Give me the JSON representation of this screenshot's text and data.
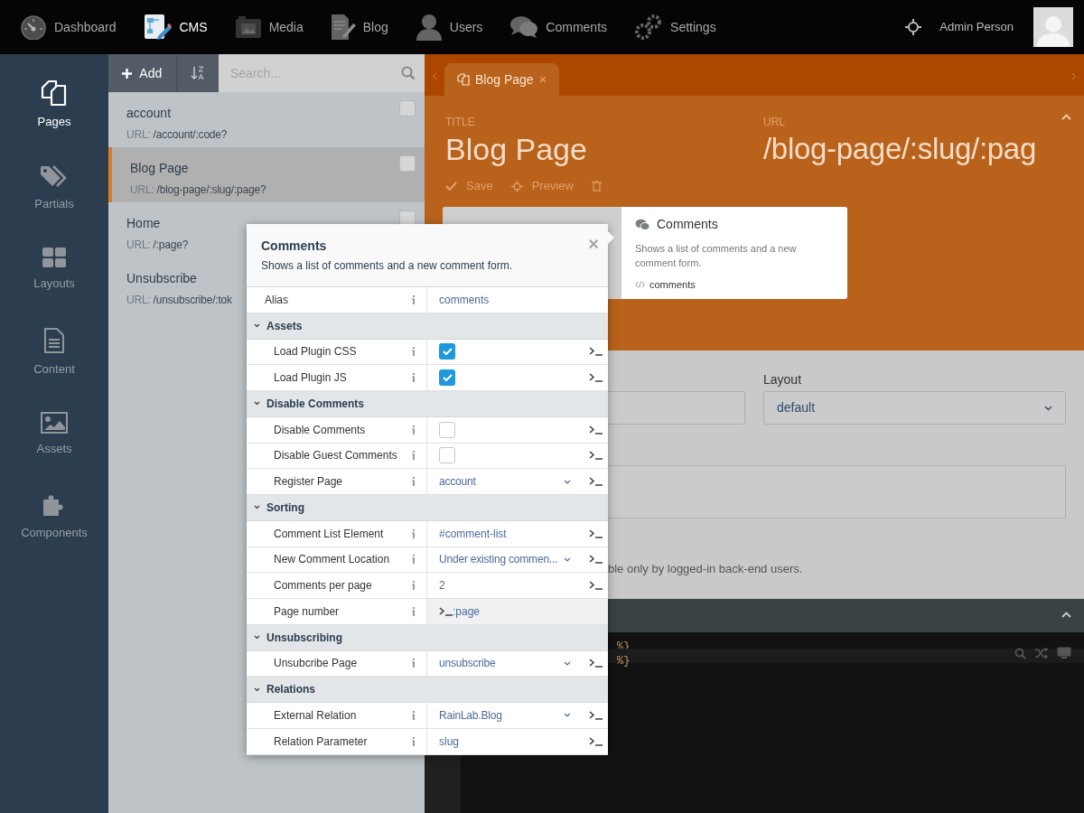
{
  "nav": {
    "items": [
      {
        "label": "Dashboard",
        "selected": false
      },
      {
        "label": "CMS",
        "selected": true
      },
      {
        "label": "Media",
        "selected": false
      },
      {
        "label": "Blog",
        "selected": false
      },
      {
        "label": "Users",
        "selected": false
      },
      {
        "label": "Comments",
        "selected": false
      },
      {
        "label": "Settings",
        "selected": false
      }
    ],
    "user": "Admin Person"
  },
  "sidebar": [
    {
      "label": "Pages",
      "selected": true
    },
    {
      "label": "Partials",
      "selected": false
    },
    {
      "label": "Layouts",
      "selected": false
    },
    {
      "label": "Content",
      "selected": false
    },
    {
      "label": "Assets",
      "selected": false
    },
    {
      "label": "Components",
      "selected": false
    }
  ],
  "list": {
    "add": "Add",
    "search_placeholder": "Search...",
    "items": [
      {
        "title": "account",
        "url_label": "URL:",
        "url": "/account/:code?",
        "selected": false
      },
      {
        "title": "Blog Page",
        "url_label": "URL:",
        "url": "/blog-page/:slug/:page?",
        "selected": true
      },
      {
        "title": "Home",
        "url_label": "URL:",
        "url": "/:page?",
        "selected": false
      },
      {
        "title": "Unsubscribe",
        "url_label": "URL:",
        "url": "/unsubscribe/:tok",
        "selected": false
      }
    ]
  },
  "editor": {
    "tab": {
      "label": "Blog Page",
      "close": "×"
    },
    "title_label": "TITLE",
    "title": "Blog Page",
    "url_label": "URL",
    "url": "/blog-page/:slug/:pag",
    "actions": [
      "Save",
      "Preview"
    ],
    "component_card": {
      "title": "Comments",
      "description": "Shows a list of comments and a new comment form.",
      "alias": "comments"
    },
    "layout_label": "Layout",
    "layout": "default",
    "hint": "ble only by logged-in back-end users.",
    "code_lines": [
      "%}",
      "%}"
    ]
  },
  "inspector": {
    "title": "Comments",
    "description": "Shows a list of comments and a new comment form.",
    "close": "×",
    "rows": [
      {
        "kind": "text",
        "label": "Alias",
        "value": "comments",
        "code_toggle": false
      },
      {
        "kind": "group",
        "label": "Assets"
      },
      {
        "kind": "checkbox",
        "label": "Load Plugin CSS",
        "checked": true,
        "code_toggle": true
      },
      {
        "kind": "checkbox",
        "label": "Load Plugin JS",
        "checked": true,
        "code_toggle": true
      },
      {
        "kind": "group",
        "label": "Disable Comments"
      },
      {
        "kind": "checkbox",
        "label": "Disable Comments",
        "checked": false,
        "code_toggle": true
      },
      {
        "kind": "checkbox",
        "label": "Disable Guest Comments",
        "checked": false,
        "code_toggle": true
      },
      {
        "kind": "dropdown",
        "label": "Register Page",
        "value": "account",
        "code_toggle": true
      },
      {
        "kind": "group",
        "label": "Sorting"
      },
      {
        "kind": "text",
        "label": "Comment List Element",
        "value": "#comment-list",
        "code_toggle": true
      },
      {
        "kind": "dropdown",
        "label": "New Comment Location",
        "value": "Under existing commen...",
        "code_toggle": true
      },
      {
        "kind": "text",
        "label": "Comments per page",
        "value": "2",
        "code_toggle": true
      },
      {
        "kind": "param",
        "label": "Page number",
        "value": ":page",
        "code_toggle": false
      },
      {
        "kind": "group",
        "label": "Unsubscribing"
      },
      {
        "kind": "dropdown",
        "label": "Unsubcribe Page",
        "value": "unsubscribe",
        "code_toggle": true
      },
      {
        "kind": "group",
        "label": "Relations"
      },
      {
        "kind": "dropdown",
        "label": "External Relation",
        "value": "RainLab.Blog",
        "code_toggle": true
      },
      {
        "kind": "text",
        "label": "Relation Parameter",
        "value": "slug",
        "code_toggle": true
      }
    ]
  }
}
